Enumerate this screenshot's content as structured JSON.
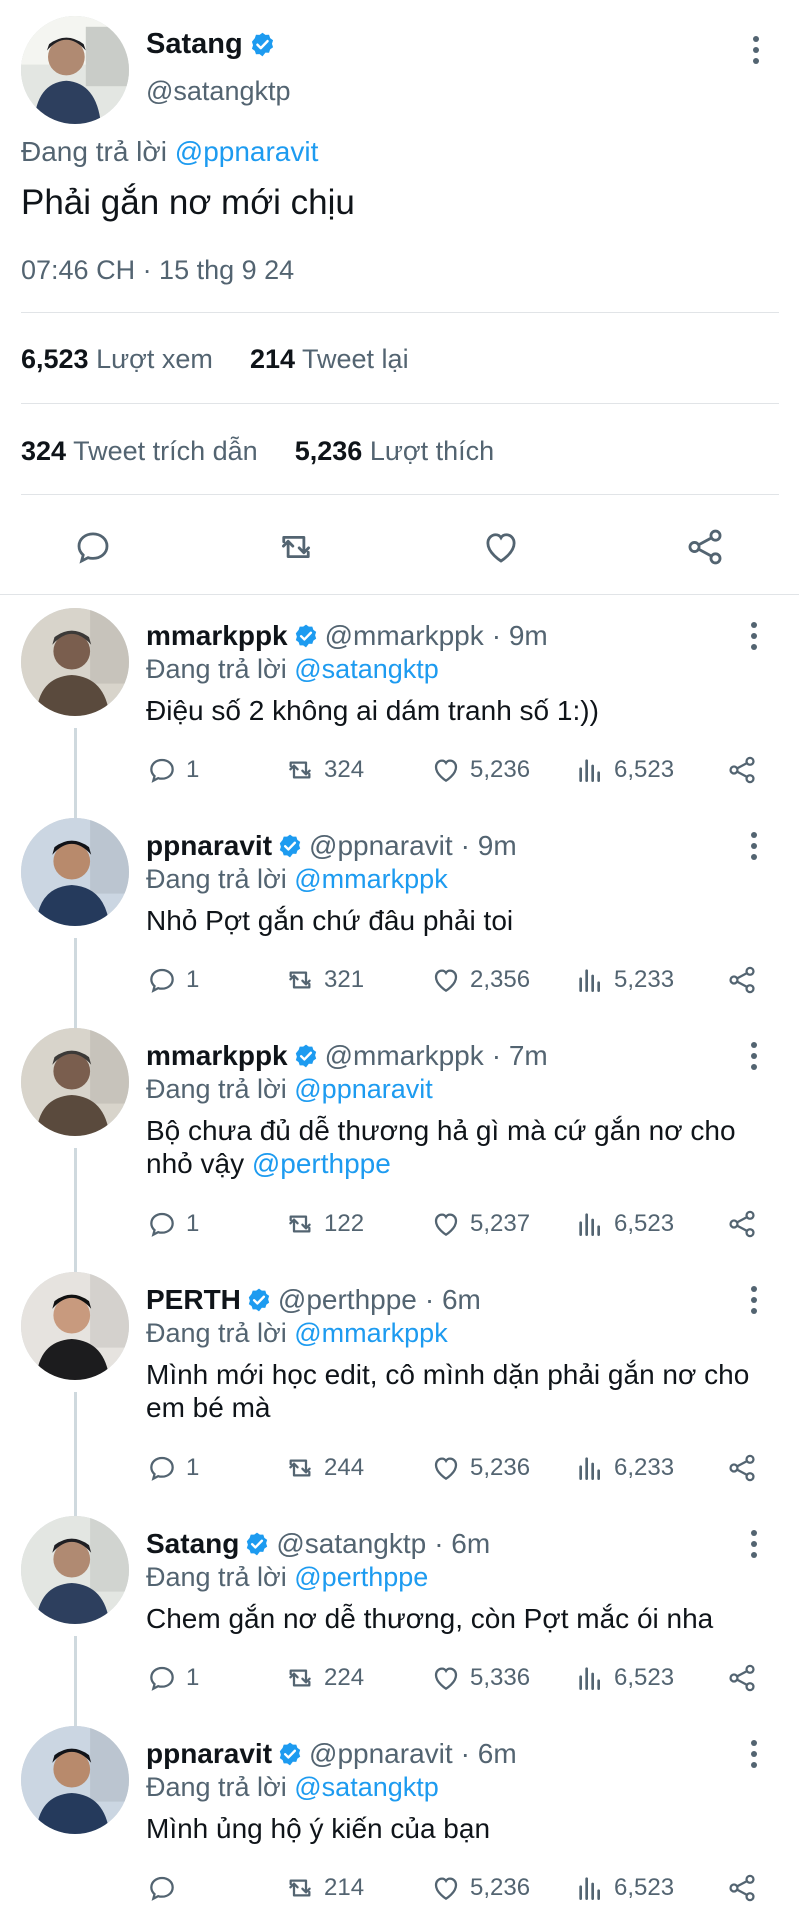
{
  "main_tweet": {
    "name": "Satang",
    "handle": "@satangktp",
    "reply_prefix": "Đang trả lời",
    "reply_to": "@ppnaravit",
    "text": "Phải gắn nơ mới chịu",
    "timestamp": "07:46 CH · 15 thg 9 24",
    "stats": {
      "views_count": "6,523",
      "views_label": "Lượt xem",
      "retweets_count": "214",
      "retweets_label": "Tweet lại",
      "quotes_count": "324",
      "quotes_label": "Tweet trích dẫn",
      "likes_count": "5,236",
      "likes_label": "Lượt thích"
    },
    "actions": [
      "reply-icon",
      "retweet-icon",
      "like-icon",
      "share-icon"
    ]
  },
  "colors": {
    "accent": "#1d9bf0",
    "muted": "#536471",
    "text": "#0f1419"
  },
  "replies": [
    {
      "name": "mmarkppk",
      "handle": "@mmarkppk",
      "time": "· 9m",
      "reply_prefix": "Đang trả lời",
      "reply_to": "@satangktp",
      "text": "Điệu số 2 không ai dám tranh số 1:))",
      "text_mention": "",
      "replies": "1",
      "retweets": "324",
      "likes": "5,236",
      "views": "6,523"
    },
    {
      "name": "ppnaravit",
      "handle": "@ppnaravit",
      "time": "· 9m",
      "reply_prefix": "Đang trả lời",
      "reply_to": "@mmarkppk",
      "text": "Nhỏ Pợt gắn chứ đâu phải toi",
      "text_mention": "",
      "replies": "1",
      "retweets": "321",
      "likes": "2,356",
      "views": "5,233"
    },
    {
      "name": "mmarkppk",
      "handle": "@mmarkppk",
      "time": "· 7m",
      "reply_prefix": "Đang trả lời",
      "reply_to": "@ppnaravit",
      "text": "Bộ chưa đủ dễ thương hả gì mà cứ gắn nơ cho nhỏ vậy ",
      "text_mention": "@perthppe",
      "replies": "1",
      "retweets": "122",
      "likes": "5,237",
      "views": "6,523"
    },
    {
      "name": "PERTH",
      "handle": "@perthppe",
      "time": "· 6m",
      "reply_prefix": "Đang trả lời",
      "reply_to": "@mmarkppk",
      "text": "Mình mới học edit, cô mình dặn phải gắn nơ cho em bé mà",
      "text_mention": "",
      "replies": "1",
      "retweets": "244",
      "likes": "5,236",
      "views": "6,233"
    },
    {
      "name": "Satang",
      "handle": "@satangktp",
      "time": "· 6m",
      "reply_prefix": "Đang trả lời",
      "reply_to": "@perthppe",
      "text": "Chem gắn nơ dễ thương, còn Pợt mắc ói nha",
      "text_mention": "",
      "replies": "1",
      "retweets": "224",
      "likes": "5,336",
      "views": "6,523"
    },
    {
      "name": "ppnaravit",
      "handle": "@ppnaravit",
      "time": "· 6m",
      "reply_prefix": "Đang trả lời",
      "reply_to": "@satangktp",
      "text": "Mình ủng hộ ý kiến của bạn",
      "text_mention": "",
      "replies": "",
      "retweets": "214",
      "likes": "5,236",
      "views": "6,523"
    }
  ]
}
